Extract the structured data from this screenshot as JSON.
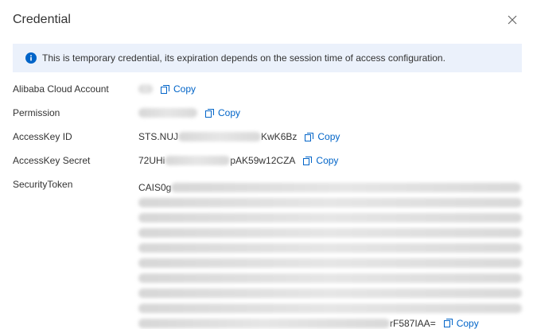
{
  "dialog": {
    "title": "Credential"
  },
  "notice": {
    "text": "This is temporary credential, its expiration depends on the session time of access configuration."
  },
  "fields": [
    {
      "label": "Alibaba Cloud Account",
      "prefix": "",
      "suffix": "",
      "copy_label": "Copy"
    },
    {
      "label": "Permission",
      "prefix": "",
      "suffix": "",
      "copy_label": "Copy"
    },
    {
      "label": "AccessKey ID",
      "prefix": "STS.NUJ",
      "suffix": "KwK6Bz",
      "copy_label": "Copy"
    },
    {
      "label": "AccessKey Secret",
      "prefix": "72UHi",
      "suffix": "pAK59w12CZA",
      "copy_label": "Copy"
    }
  ],
  "token": {
    "label": "SecurityToken",
    "prefix": "CAIS0g",
    "suffix": "rF587IAA=",
    "copy_label": "Copy"
  },
  "colors": {
    "accent": "#0064c8",
    "notice_bg": "#ebf1fb",
    "info_icon": "#0064c8"
  }
}
